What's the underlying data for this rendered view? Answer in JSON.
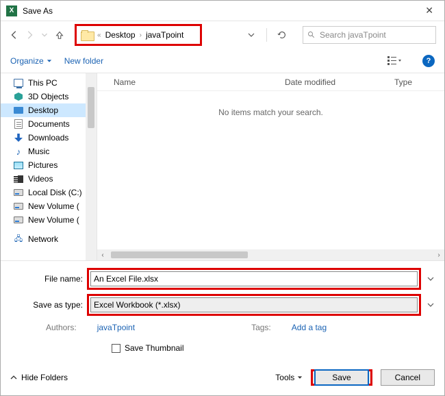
{
  "title": "Save As",
  "breadcrumb": {
    "prefix": "«",
    "seg1": "Desktop",
    "seg2": "javaTpoint"
  },
  "search": {
    "placeholder": "Search javaTpoint"
  },
  "toolbar": {
    "organize": "Organize",
    "newfolder": "New folder"
  },
  "columns": {
    "name": "Name",
    "date": "Date modified",
    "type": "Type"
  },
  "empty_msg": "No items match your search.",
  "tree": {
    "thispc": "This PC",
    "objects3d": "3D Objects",
    "desktop": "Desktop",
    "documents": "Documents",
    "downloads": "Downloads",
    "music": "Music",
    "pictures": "Pictures",
    "videos": "Videos",
    "localc": "Local Disk (C:)",
    "newvol1": "New Volume (",
    "newvol2": "New Volume (",
    "network": "Network"
  },
  "fields": {
    "filename_label": "File name:",
    "filename_value": "An Excel File.xlsx",
    "savetype_label": "Save as type:",
    "savetype_value": "Excel Workbook (*.xlsx)"
  },
  "meta": {
    "authors_label": "Authors:",
    "authors_value": "javaTpoint",
    "tags_label": "Tags:",
    "tags_value": "Add a tag"
  },
  "thumb_label": "Save Thumbnail",
  "footer": {
    "hide": "Hide Folders",
    "tools": "Tools",
    "save": "Save",
    "cancel": "Cancel"
  }
}
